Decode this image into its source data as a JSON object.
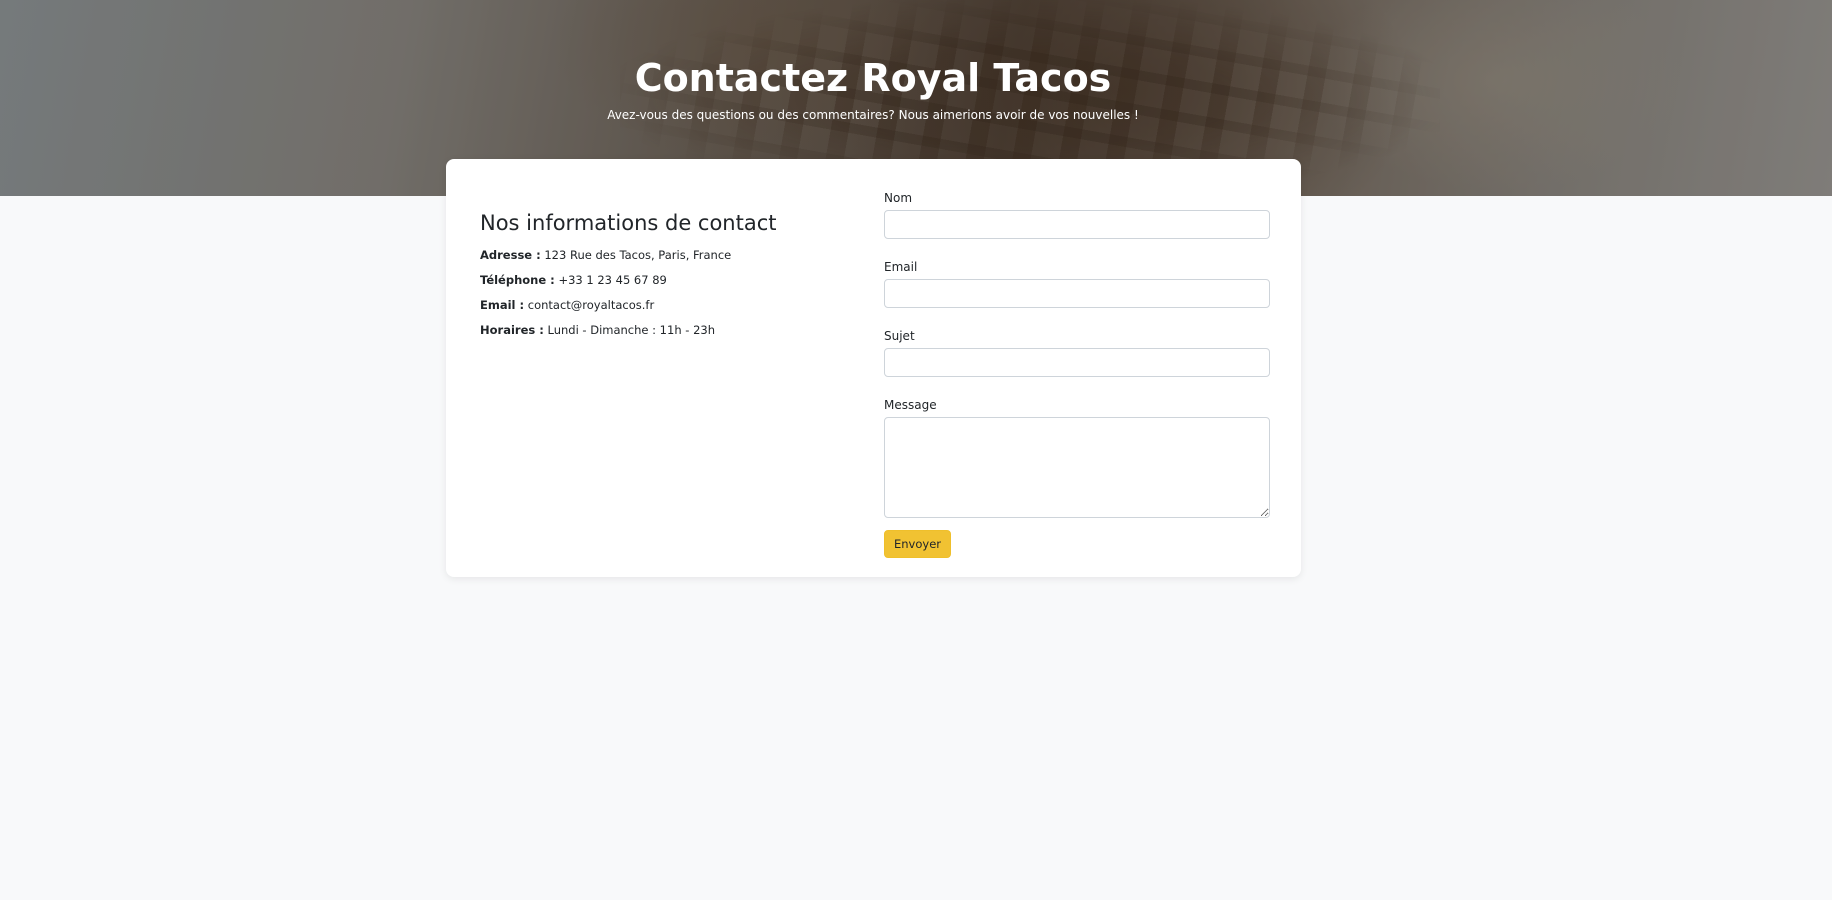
{
  "hero": {
    "title": "Contactez Royal Tacos",
    "subtitle": "Avez-vous des questions ou des commentaires? Nous aimerions avoir de vos nouvelles !"
  },
  "contact_info": {
    "heading": "Nos informations de contact",
    "items": [
      {
        "label": "Adresse :",
        "value": "123 Rue des Tacos, Paris, France"
      },
      {
        "label": "Téléphone :",
        "value": "+33 1 23 45 67 89"
      },
      {
        "label": "Email :",
        "value": "contact@royaltacos.fr"
      },
      {
        "label": "Horaires :",
        "value": "Lundi - Dimanche : 11h - 23h"
      }
    ]
  },
  "form": {
    "name_label": "Nom",
    "name_value": "",
    "email_label": "Email",
    "email_value": "",
    "subject_label": "Sujet",
    "subject_value": "",
    "message_label": "Message",
    "message_value": "",
    "submit_label": "Envoyer"
  },
  "colors": {
    "page_background": "#f8f9fa",
    "card_background": "#ffffff",
    "accent_button": "#f1c232",
    "hero_text": "#ffffff"
  }
}
